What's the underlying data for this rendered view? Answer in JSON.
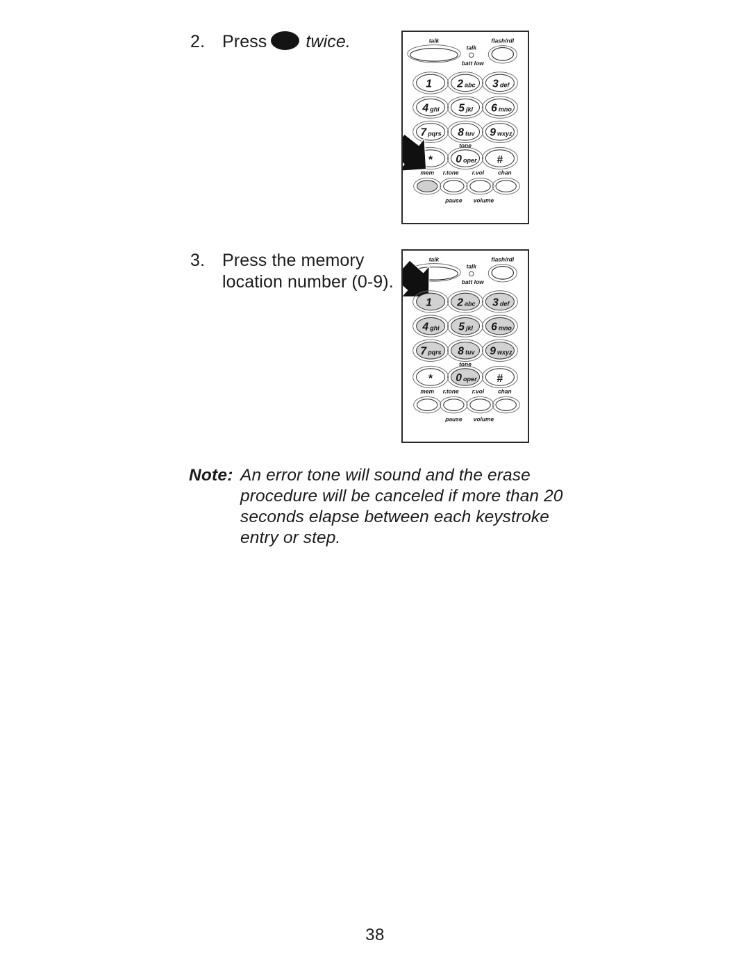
{
  "page": {
    "number": "38"
  },
  "steps": [
    {
      "number": "2.",
      "text_before": "Press",
      "button_glyph": "mem-button-glyph",
      "text_after": "twice."
    },
    {
      "number": "3.",
      "line1": "Press the memory",
      "line2": "location number (0-9)."
    }
  ],
  "note": {
    "label": "Note:",
    "body": "An error tone will sound and the erase procedure will be canceled if more than 20 seconds elapse between each keystroke entry or step."
  },
  "keypads": [
    {
      "id": "keypad-1",
      "caption_for_step": "2.",
      "top_labels": {
        "talk_button": "talk",
        "flash_redial_button": "flash/rdl",
        "led_top": "talk",
        "led_bottom": "batt low"
      },
      "keys": [
        {
          "digit": "1",
          "letters": "",
          "highlighted": false
        },
        {
          "digit": "2",
          "letters": "abc",
          "highlighted": false
        },
        {
          "digit": "3",
          "letters": "def",
          "highlighted": false
        },
        {
          "digit": "4",
          "letters": "ghi",
          "highlighted": false
        },
        {
          "digit": "5",
          "letters": "jkl",
          "highlighted": false
        },
        {
          "digit": "6",
          "letters": "mno",
          "highlighted": false
        },
        {
          "digit": "7",
          "letters": "pqrs",
          "highlighted": false
        },
        {
          "digit": "8",
          "letters": "tuv",
          "highlighted": false
        },
        {
          "digit": "9",
          "letters": "wxyz",
          "highlighted": false
        },
        {
          "digit": "*",
          "letters": "",
          "highlighted": false
        },
        {
          "digit": "0",
          "letters": "oper",
          "highlighted": false
        },
        {
          "digit": "#",
          "letters": "",
          "highlighted": false
        }
      ],
      "tone_label": "tone",
      "function_row": {
        "above_labels": [
          "mem",
          "r.tone",
          "r.vol",
          "chan"
        ],
        "below_labels": [
          "pause",
          "volume"
        ],
        "highlighted": [
          "mem"
        ]
      },
      "arrow": {
        "points_to": "mem-key",
        "direction": "down-right"
      }
    },
    {
      "id": "keypad-2",
      "caption_for_step": "3.",
      "top_labels": {
        "talk_button": "talk",
        "flash_redial_button": "flash/rdl",
        "led_top": "talk",
        "led_bottom": "batt low"
      },
      "keys": [
        {
          "digit": "1",
          "letters": "",
          "highlighted": true
        },
        {
          "digit": "2",
          "letters": "abc",
          "highlighted": true
        },
        {
          "digit": "3",
          "letters": "def",
          "highlighted": true
        },
        {
          "digit": "4",
          "letters": "ghi",
          "highlighted": true
        },
        {
          "digit": "5",
          "letters": "jkl",
          "highlighted": true
        },
        {
          "digit": "6",
          "letters": "mno",
          "highlighted": true
        },
        {
          "digit": "7",
          "letters": "pqrs",
          "highlighted": true
        },
        {
          "digit": "8",
          "letters": "tuv",
          "highlighted": true
        },
        {
          "digit": "9",
          "letters": "wxyz",
          "highlighted": true
        },
        {
          "digit": "*",
          "letters": "",
          "highlighted": false
        },
        {
          "digit": "0",
          "letters": "oper",
          "highlighted": true
        },
        {
          "digit": "#",
          "letters": "",
          "highlighted": false
        }
      ],
      "tone_label": "tone",
      "function_row": {
        "above_labels": [
          "mem",
          "r.tone",
          "r.vol",
          "chan"
        ],
        "below_labels": [
          "pause",
          "volume"
        ],
        "highlighted": []
      },
      "arrow": {
        "points_to": "number-keys",
        "direction": "down-right"
      }
    }
  ],
  "colors": {
    "ink": "#1b1b1b",
    "key_highlight": "#d2d2d2",
    "key_stroke": "#3a3a3a",
    "box_border": "#2b2b2b",
    "arrow_fill": "#101010"
  }
}
